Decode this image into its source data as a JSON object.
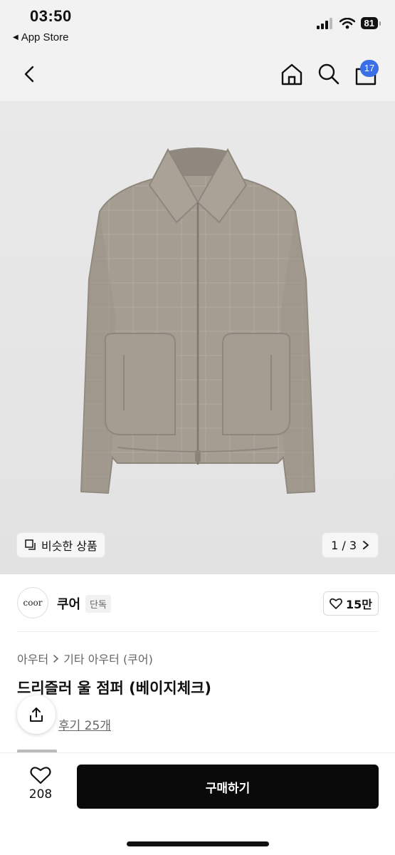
{
  "status_bar": {
    "time": "03:50",
    "back_app": "App Store",
    "battery": "81"
  },
  "nav": {
    "back_icon": "chevron-left-icon",
    "home_icon": "home-icon",
    "search_icon": "search-icon",
    "bag_icon": "shopping-bag-icon",
    "bag_badge": "17",
    "badge_color": "#3b6fe8"
  },
  "gallery": {
    "similar_label": "비슷한 상품",
    "pager": "1 / 3"
  },
  "brand": {
    "logo_text": "coor",
    "name": "쿠어",
    "tag": "단독",
    "likes": "15만"
  },
  "product": {
    "breadcrumb": [
      "아우터",
      "기타 아우터 (쿠어)"
    ],
    "title": "드리즐러 울 점퍼 (베이지체크)",
    "review_link": "후기 25개"
  },
  "bottom": {
    "wish_count": "208",
    "buy_label": "구매하기"
  }
}
